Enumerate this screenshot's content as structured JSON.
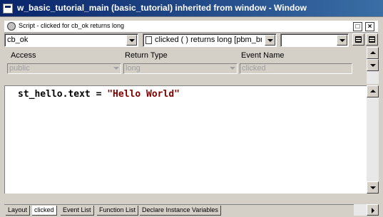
{
  "window": {
    "title": "w_basic_tutorial_main (basic_tutorial) inherited from window - Window"
  },
  "script_pane": {
    "title": "Script - clicked for cb_ok returns long",
    "object_combo": "cb_ok",
    "event_combo": "clicked ( )  returns long [pbm_bn",
    "third_combo": ""
  },
  "headers": {
    "access": "Access",
    "return_type": "Return Type",
    "event_name": "Event Name"
  },
  "fields": {
    "access": "public",
    "return_type": "long",
    "event_name": "clicked"
  },
  "code": {
    "prefix": "st_hello.text = ",
    "string": "\"Hello World\""
  },
  "tabs": [
    {
      "label": "Layout"
    },
    {
      "label": "clicked"
    },
    {
      "label": "Event List"
    },
    {
      "label": "Function List"
    },
    {
      "label": "Declare Instance Variables"
    }
  ],
  "icons": {
    "window": "window-icon",
    "script": "script-icon",
    "maximize": "maximize-icon",
    "close": "close-icon"
  },
  "colors": {
    "title_bar": "#0a246a",
    "code_string": "#800000",
    "face": "#d4d0c8"
  }
}
